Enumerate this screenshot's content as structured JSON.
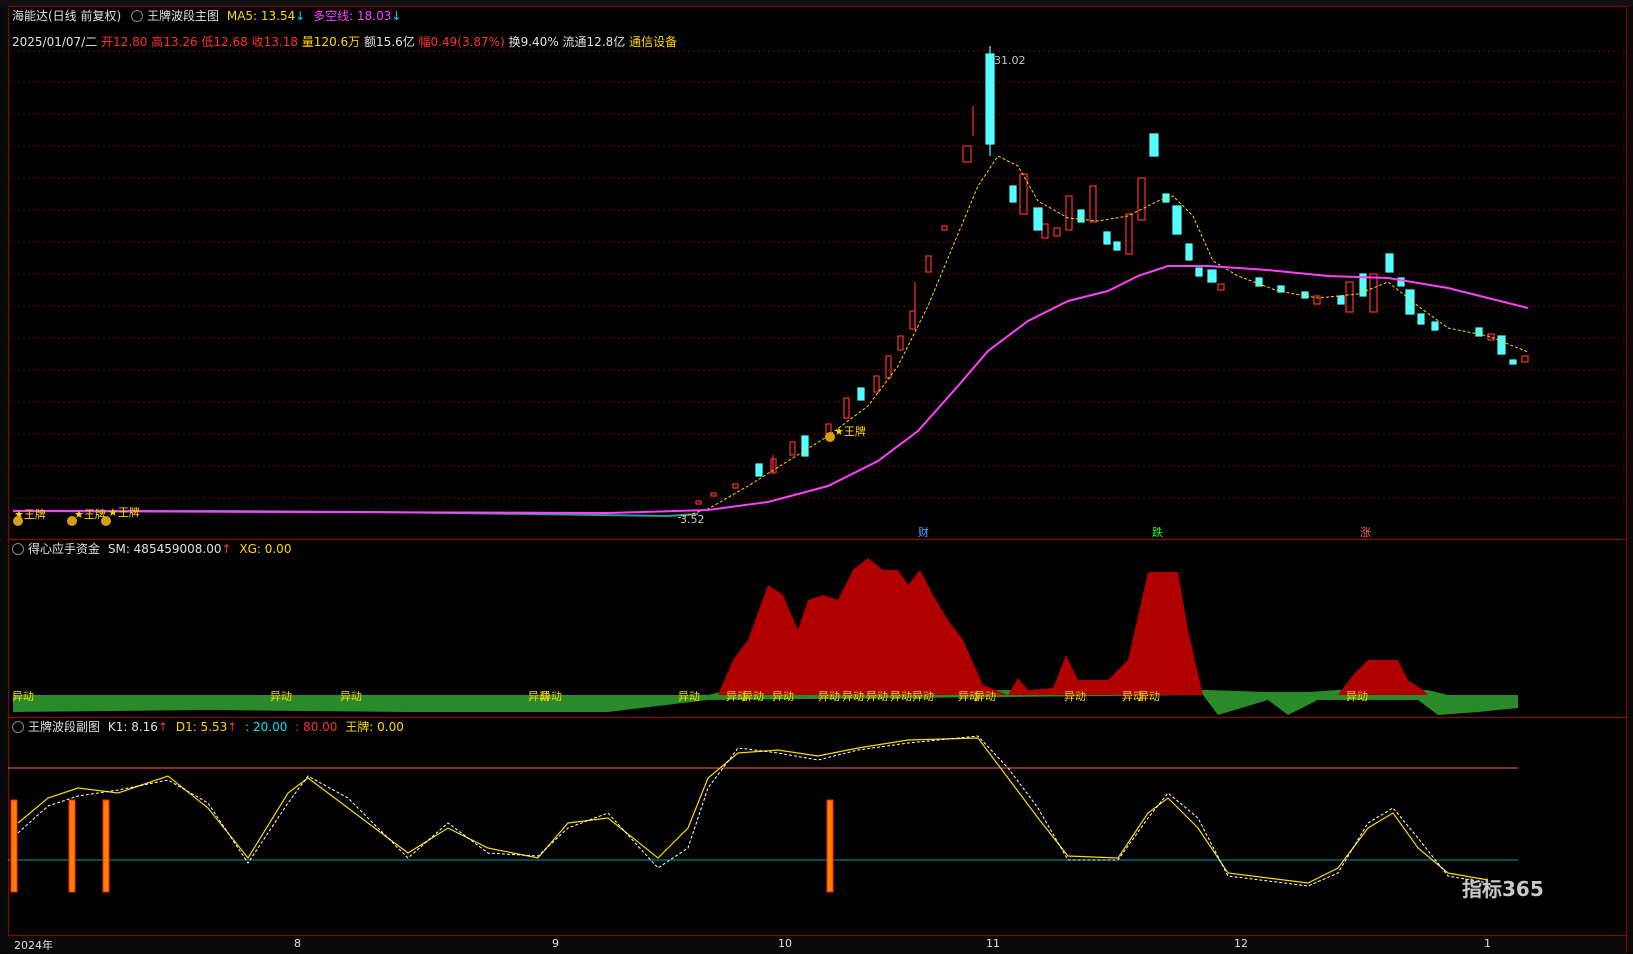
{
  "main": {
    "stock": "海能达(日线 前复权)",
    "indicator": "王牌波段主图",
    "ma5_label": "MA5: 13.54",
    "ma5_arrow": "↓",
    "dk_label": "多空线: 18.03",
    "dk_arrow": "↓",
    "info": {
      "date": "2025/01/07/二",
      "open": "开12.80",
      "high": "高13.26",
      "low": "低12.68",
      "close": "收13.18",
      "vol": "量120.6万",
      "amount": "额15.6亿",
      "change": "幅0.49(3.87%)",
      "turnover": "换9.40%",
      "float": "流通12.8亿",
      "sector": "通信设备"
    },
    "high_mark": "31.02",
    "low_mark": "3.52",
    "wangpai": "★王牌",
    "events": {
      "cai": "财",
      "die": "跌",
      "zhang": "涨"
    }
  },
  "fund": {
    "title": "得心应手资金",
    "sm": "SM: 485459008.00",
    "sm_arrow": "↑",
    "xg": "XG: 0.00",
    "yidong": "异动"
  },
  "sub": {
    "title": "王牌波段副图",
    "k1": "K1: 8.16",
    "k1_arrow": "↑",
    "d1": "D1: 5.53",
    "d1_arrow": "↑",
    "l20": ": 20.00",
    "l80": ": 80.00",
    "wp": "王牌: 0.00"
  },
  "xaxis": {
    "year": "2024年",
    "m8": "8",
    "m9": "9",
    "m10": "10",
    "m11": "11",
    "m12": "12",
    "m1": "1"
  },
  "watermark": "指标365",
  "colors": {
    "up": "#ff3030",
    "down": "#54ffff",
    "ma5": "#ffd700",
    "dk": "#ff40ff",
    "fund": "#b00000",
    "yidong_bar": "#2a8a2a"
  }
}
